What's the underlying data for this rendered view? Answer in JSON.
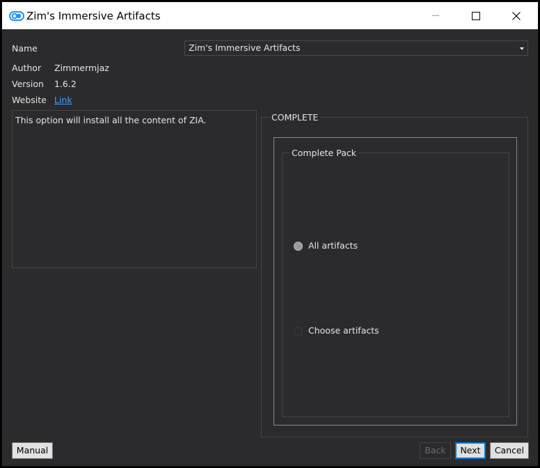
{
  "window": {
    "title": "Zim's Immersive Artifacts",
    "icon": "infinity-loop-icon",
    "controls": [
      "minimize-icon",
      "maximize-icon",
      "close-icon"
    ]
  },
  "info": {
    "name_label": "Name",
    "name_value": "Zim's Immersive Artifacts",
    "author_label": "Author",
    "author_value": "Zimmermjaz",
    "version_label": "Version",
    "version_value": "1.6.2",
    "website_label": "Website",
    "website_link": "Link"
  },
  "description": "This option will install all the content of ZIA.",
  "option_group": {
    "title": "COMPLETE",
    "pack_title": "Complete Pack",
    "options": [
      {
        "label": "All artifacts",
        "selected": true
      },
      {
        "label": "Choose artifacts",
        "selected": false
      }
    ]
  },
  "buttons": {
    "manual": "Manual",
    "back": "Back",
    "next": "Next",
    "cancel": "Cancel"
  },
  "colors": {
    "background": "#2b2b2d",
    "text": "#e6e6e6",
    "link": "#4a9eff",
    "accent": "#0078d7",
    "icon": "#1e90ff"
  }
}
